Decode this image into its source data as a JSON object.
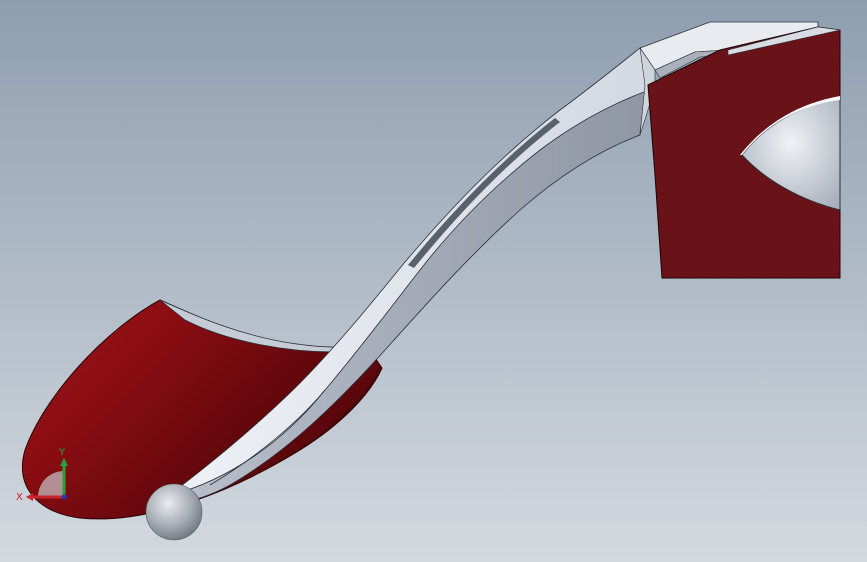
{
  "viewport": {
    "background_top": "#8e9eb0",
    "background_bottom": "#d4d9df"
  },
  "model": {
    "colors": {
      "red_face": "#8a0d12",
      "red_dark": "#3f0608",
      "hatch_red": "#6e1419",
      "steel_light": "#eef1f6",
      "steel_mid": "#c6ccd6",
      "steel_dark": "#8f96a3",
      "edge": "#2a2f38",
      "sphere": "#9aa0aa"
    }
  },
  "triad": {
    "x_label": "X",
    "y_label": "Y",
    "x_color": "#c9242b",
    "y_color": "#27a33c",
    "z_color": "#2138b8"
  }
}
